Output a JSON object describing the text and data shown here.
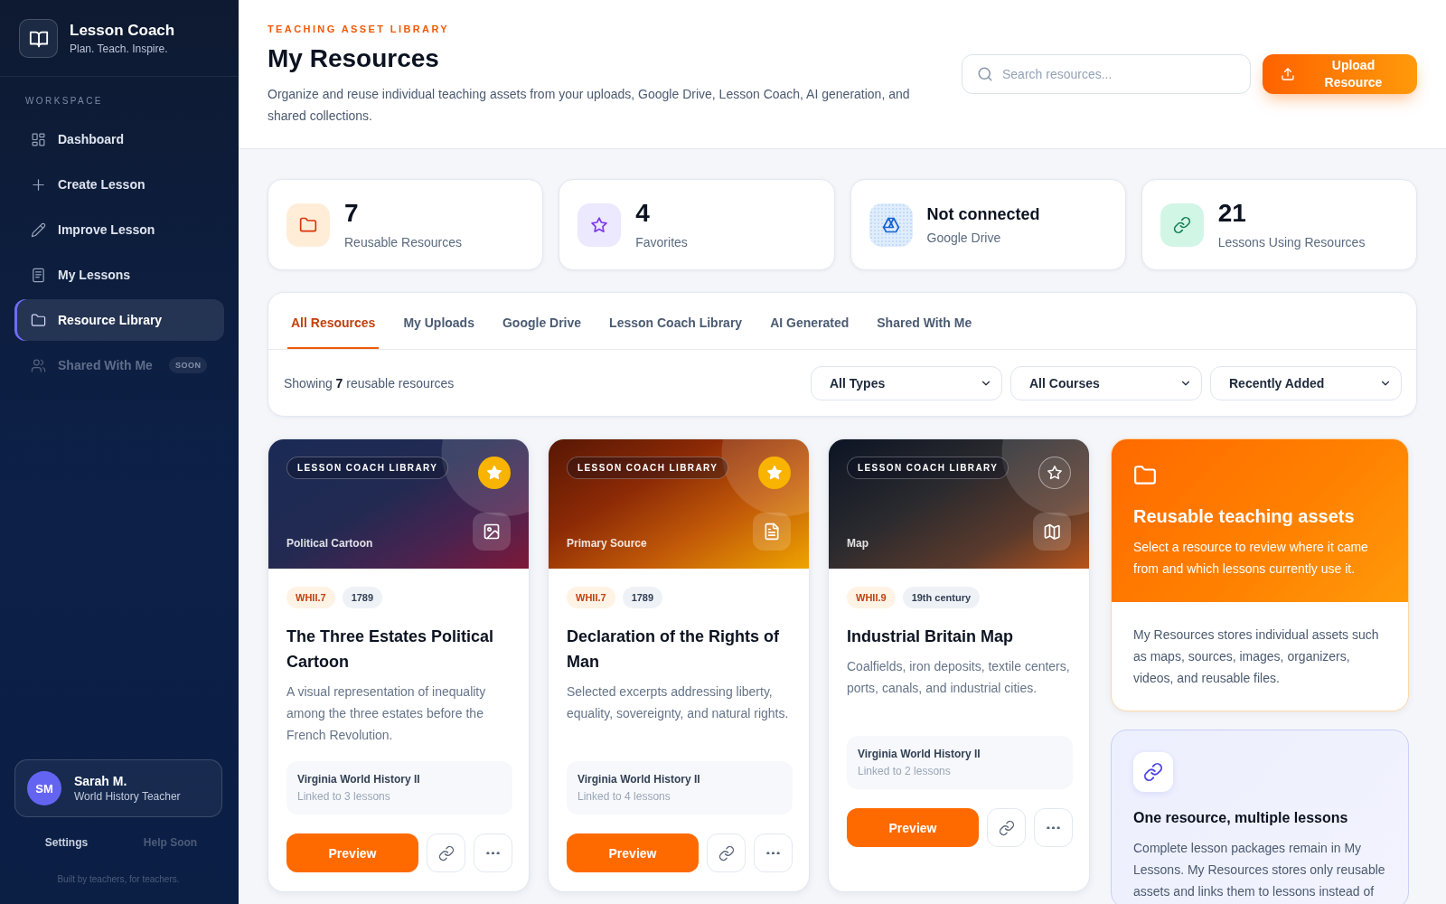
{
  "sidebar": {
    "brand": {
      "title": "Lesson Coach",
      "tagline": "Plan. Teach. Inspire."
    },
    "section_label": "WORKSPACE",
    "items": [
      {
        "label": "Dashboard",
        "kind": "dashboard",
        "selected": false,
        "disabled": false
      },
      {
        "label": "Create Lesson",
        "kind": "create",
        "selected": false,
        "disabled": false
      },
      {
        "label": "Improve Lesson",
        "kind": "improve",
        "selected": false,
        "disabled": false
      },
      {
        "label": "My Lessons",
        "kind": "lessons",
        "selected": false,
        "disabled": false
      },
      {
        "label": "Resource Library",
        "kind": "library",
        "selected": true,
        "disabled": false
      },
      {
        "label": "Shared With Me",
        "kind": "shared",
        "selected": false,
        "disabled": true,
        "badge": "SOON"
      }
    ],
    "user": {
      "initials": "SM",
      "name": "Sarah M.",
      "role": "World History Teacher"
    },
    "footer_links": [
      {
        "label": "Settings",
        "disabled": false
      },
      {
        "label": "Help Soon",
        "disabled": true
      }
    ],
    "footnote": "Built by teachers, for teachers."
  },
  "header": {
    "eyebrow": "TEACHING ASSET LIBRARY",
    "title": "My Resources",
    "description": "Organize and reuse individual teaching assets from your uploads, Google Drive, Lesson Coach, AI generation, and shared collections.",
    "search": {
      "placeholder": "Search resources..."
    },
    "upload_button": "Upload Resource"
  },
  "stats": [
    {
      "kind": "resources",
      "value": "7",
      "label": "Reusable Resources"
    },
    {
      "kind": "favorites",
      "value": "4",
      "label": "Favorites"
    },
    {
      "kind": "drive",
      "value": "Not connected",
      "label": "Google Drive"
    },
    {
      "kind": "lessons",
      "value": "21",
      "label": "Lessons Using Resources"
    }
  ],
  "library": {
    "tabs": [
      {
        "label": "All Resources",
        "selected": true
      },
      {
        "label": "My Uploads",
        "selected": false
      },
      {
        "label": "Google Drive",
        "selected": false
      },
      {
        "label": "Lesson Coach Library",
        "selected": false
      },
      {
        "label": "AI Generated",
        "selected": false
      },
      {
        "label": "Shared With Me",
        "selected": false
      }
    ],
    "summary": "Showing **7** reusable resources",
    "filters": [
      "All Types",
      "All Courses",
      "Recently Added"
    ]
  },
  "resources": [
    {
      "source": "LESSON COACH LIBRARY",
      "favorite": true,
      "kind": "cartoon",
      "type": "Political Cartoon",
      "tags": [
        {
          "label": "WHII.7",
          "kind": "standard"
        },
        {
          "label": "1789",
          "kind": "era"
        }
      ],
      "title": "The Three Estates Political Cartoon",
      "description": "A visual representation of inequality among the three estates before the French Revolution.",
      "course": "Virginia World History II",
      "linked": "Linked to 3 lessons",
      "preview_label": "Preview"
    },
    {
      "source": "LESSON COACH LIBRARY",
      "favorite": true,
      "kind": "source",
      "type": "Primary Source",
      "tags": [
        {
          "label": "WHII.7",
          "kind": "standard"
        },
        {
          "label": "1789",
          "kind": "era"
        }
      ],
      "title": "Declaration of the Rights of Man",
      "description": "Selected excerpts addressing liberty, equality, sovereignty, and natural rights.",
      "course": "Virginia World History II",
      "linked": "Linked to 4 lessons",
      "preview_label": "Preview"
    },
    {
      "source": "LESSON COACH LIBRARY",
      "favorite": false,
      "kind": "map",
      "type": "Map",
      "tags": [
        {
          "label": "WHII.9",
          "kind": "standard"
        },
        {
          "label": "19th century",
          "kind": "era"
        }
      ],
      "title": "Industrial Britain Map",
      "description": "Coalfields, iron deposits, textile centers, ports, canals, and industrial cities.",
      "course": "Virginia World History II",
      "linked": "Linked to 2 lessons",
      "preview_label": "Preview"
    }
  ],
  "info_panels": [
    {
      "kind": "highlight",
      "title": "Reusable teaching assets",
      "lead": "Select a resource to review where it came from and which lessons currently use it.",
      "body": "My Resources stores individual assets such as maps, sources, images, organizers, videos, and reusable files."
    },
    {
      "kind": "note",
      "title": "One resource, multiple lessons",
      "body": "Complete lesson packages remain in My Lessons. My Resources stores only reusable assets and links them to lessons instead of"
    }
  ]
}
